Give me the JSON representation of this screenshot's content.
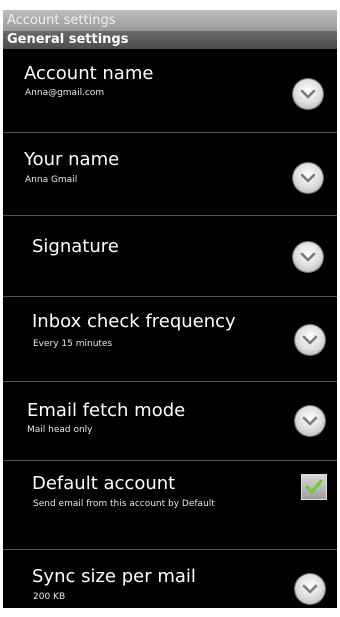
{
  "title_bar": {
    "text": "Account settings"
  },
  "section": {
    "header": "General settings"
  },
  "settings": [
    {
      "title": "Account name",
      "summary": "Anna@gmail.com"
    },
    {
      "title": "Your name",
      "summary": "Anna Gmail"
    },
    {
      "title": "Signature",
      "summary": ""
    },
    {
      "title": "Inbox check frequency",
      "summary": "Every 15 minutes"
    },
    {
      "title": "Email fetch mode",
      "summary": "Mail head only"
    },
    {
      "title": "Default account",
      "summary": "Send email from this account by Default",
      "checked": true
    },
    {
      "title": "Sync size per mail",
      "summary": "200 KB"
    }
  ],
  "icons": {
    "dropdown": "chevron-down-icon",
    "check": "checkmark-icon"
  },
  "colors": {
    "background": "#000000",
    "header": "#555555",
    "check": "#6bd02a"
  }
}
